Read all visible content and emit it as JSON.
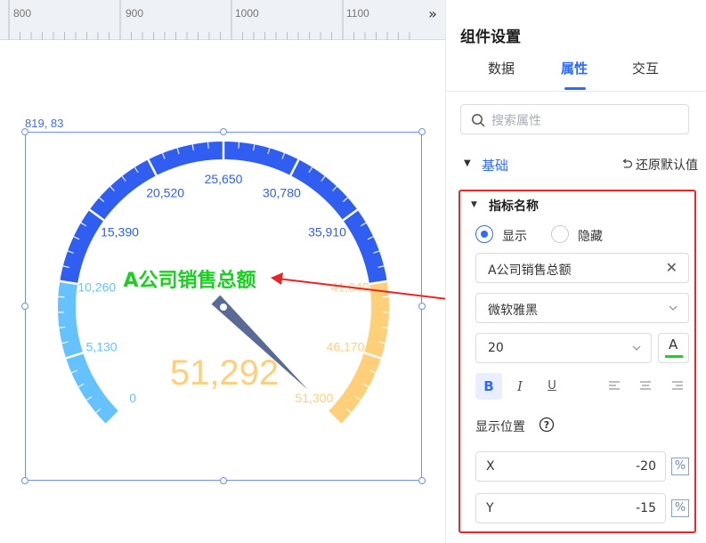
{
  "ruler": {
    "labels": [
      "800",
      "900",
      "1000",
      "1100"
    ],
    "collapse_icon": "double-chevron-right-icon"
  },
  "canvas": {
    "coordinate_readout": "819, 83"
  },
  "gauge": {
    "title": "A公司销售总额",
    "value": "51,292",
    "ticks": [
      "0",
      "5,130",
      "10,260",
      "15,390",
      "20,520",
      "25,650",
      "30,780",
      "35,910",
      "41,040",
      "46,170",
      "51,300"
    ],
    "colors": {
      "low": "#66c2ff",
      "mid": "#2f5ef0",
      "high": "#ffcf7a",
      "title": "#17d11d",
      "needle": "#5a6a96",
      "annotation": "#e82424"
    }
  },
  "panel": {
    "title": "组件设置",
    "tabs": [
      "数据",
      "属性",
      "交互"
    ],
    "active_tab": "属性",
    "search": {
      "placeholder": "搜索属性",
      "value": ""
    },
    "basic_section": {
      "label": "基础",
      "reset_label": "还原默认值"
    },
    "indicator_section": {
      "title": "指标名称",
      "show_label": "显示",
      "hide_label": "隐藏",
      "selected": "显示",
      "name_value": "A公司销售总额",
      "font_value": "微软雅黑",
      "size_value": "20",
      "font_color_label": "A",
      "font_color": "#1fd11f",
      "bold_label": "B",
      "italic_label": "I",
      "underline_label": "U",
      "position_label": "显示位置",
      "x_label": "X",
      "x_value": "-20",
      "y_label": "Y",
      "y_value": "-15",
      "unit_label": "%"
    }
  }
}
